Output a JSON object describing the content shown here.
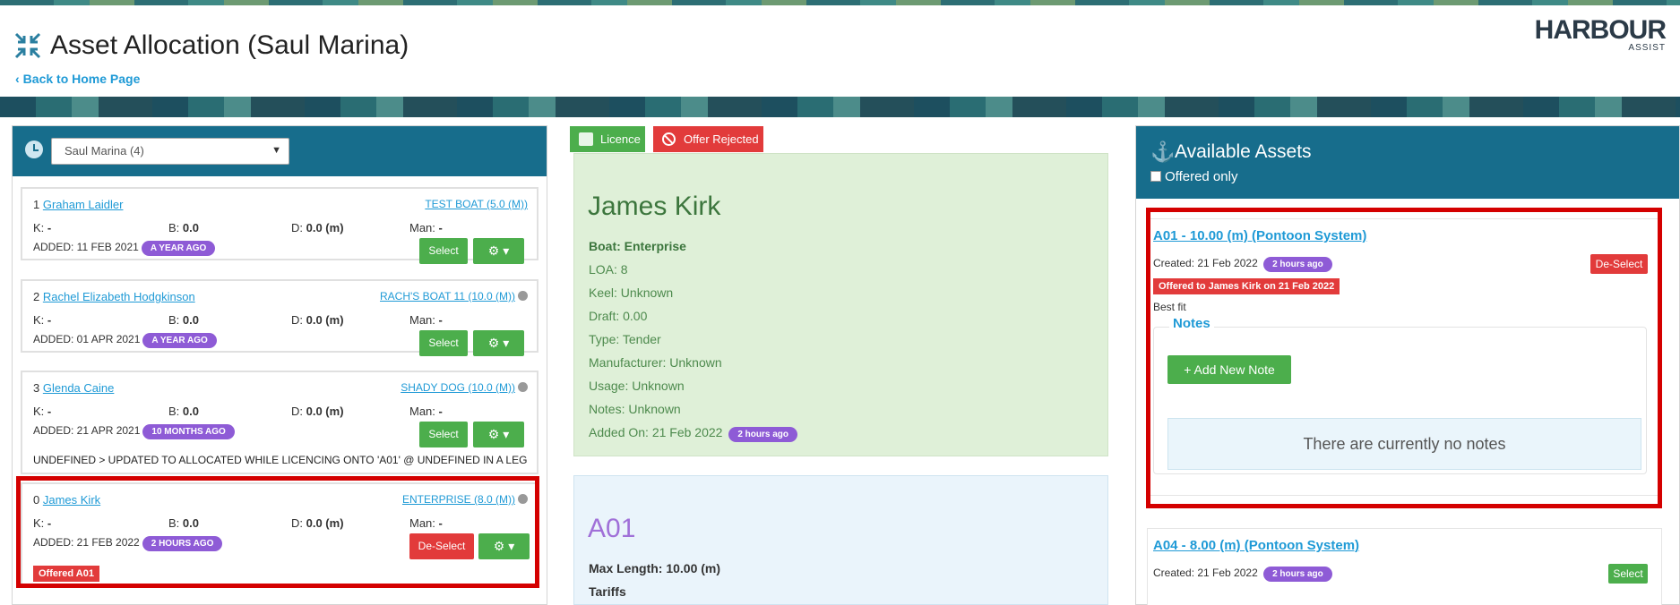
{
  "header": {
    "title": "Asset Allocation (Saul Marina)",
    "back_link": "Back to Home Page",
    "logo_main": "HARBOUR",
    "logo_sub": "ASSIST"
  },
  "left": {
    "select_value": "Saul Marina (4)",
    "cards": [
      {
        "index": "1",
        "name": "Graham Laidler",
        "boat": "TEST BOAT (5.0 (M))",
        "k_label": "K:",
        "k_value": "-",
        "b_label": "B:",
        "b_value": "0.0",
        "d_label": "D:",
        "d_value": "0.0 (m)",
        "man_label": "Man:",
        "man_value": "-",
        "added": "ADDED: 11 FEB 2021",
        "ago": "A YEAR AGO",
        "action": "Select"
      },
      {
        "index": "2",
        "name": "Rachel Elizabeth Hodgkinson",
        "boat": "RACH'S BOAT 11 (10.0 (M))",
        "k_label": "K:",
        "k_value": "-",
        "b_label": "B:",
        "b_value": "0.0",
        "d_label": "D:",
        "d_value": "0.0 (m)",
        "man_label": "Man:",
        "man_value": "-",
        "added": "ADDED: 01 APR 2021",
        "ago": "A YEAR AGO",
        "action": "Select"
      },
      {
        "index": "3",
        "name": "Glenda Caine",
        "boat": "SHADY DOG (10.0 (M))",
        "k_label": "K:",
        "k_value": "-",
        "b_label": "B:",
        "b_value": "0.0",
        "d_label": "D:",
        "d_value": "0.0 (m)",
        "man_label": "Man:",
        "man_value": "-",
        "added": "ADDED: 21 APR 2021",
        "ago": "10 MONTHS AGO",
        "action": "Select",
        "note": "UNDEFINED > UPDATED TO ALLOCATED WHILE LICENCING ONTO 'A01' @ UNDEFINED IN A LEG"
      },
      {
        "index": "0",
        "name": "James Kirk",
        "boat": "ENTERPRISE (8.0 (M))",
        "k_label": "K:",
        "k_value": "-",
        "b_label": "B:",
        "b_value": "0.0",
        "d_label": "D:",
        "d_value": "0.0 (m)",
        "man_label": "Man:",
        "man_value": "-",
        "added": "ADDED: 21 FEB 2022",
        "ago": "2 HOURS AGO",
        "action": "De-Select",
        "offered": "Offered A01"
      }
    ]
  },
  "middle": {
    "licence_badge": "Licence",
    "rejected_badge": "Offer Rejected",
    "person": {
      "name": "James Kirk",
      "boat": "Boat: Enterprise",
      "loa": "LOA: 8",
      "keel": "Keel: Unknown",
      "draft": "Draft: 0.00",
      "type": "Type: Tender",
      "manufacturer": "Manufacturer: Unknown",
      "usage": "Usage: Unknown",
      "notes": "Notes: Unknown",
      "added_on": "Added On: 21 Feb 2022",
      "ago": "2 hours ago"
    },
    "asset": {
      "name": "A01",
      "max_length": "Max Length: 10.00 (m)",
      "tariffs": "Tariffs"
    }
  },
  "right": {
    "title": "Available Assets",
    "offered_only": "Offered only",
    "assets": [
      {
        "title": "A01 - 10.00 (m) (Pontoon System)",
        "created": "Created: 21 Feb 2022",
        "ago": "2 hours ago",
        "action": "De-Select",
        "offered_to": "Offered to James Kirk on 21 Feb 2022",
        "best_fit": "Best fit",
        "notes_title": "Notes",
        "add_note": "+ Add New Note",
        "no_notes": "There are currently no notes"
      },
      {
        "title": "A04 - 8.00 (m) (Pontoon System)",
        "created": "Created: 21 Feb 2022",
        "ago": "2 hours ago",
        "action": "Select"
      }
    ]
  },
  "colors": {
    "header_teal": "#176d8c",
    "green": "#4cae4c",
    "red": "#e23b3b",
    "purple": "#8e5bd6",
    "link_blue": "#1f9ad6"
  }
}
